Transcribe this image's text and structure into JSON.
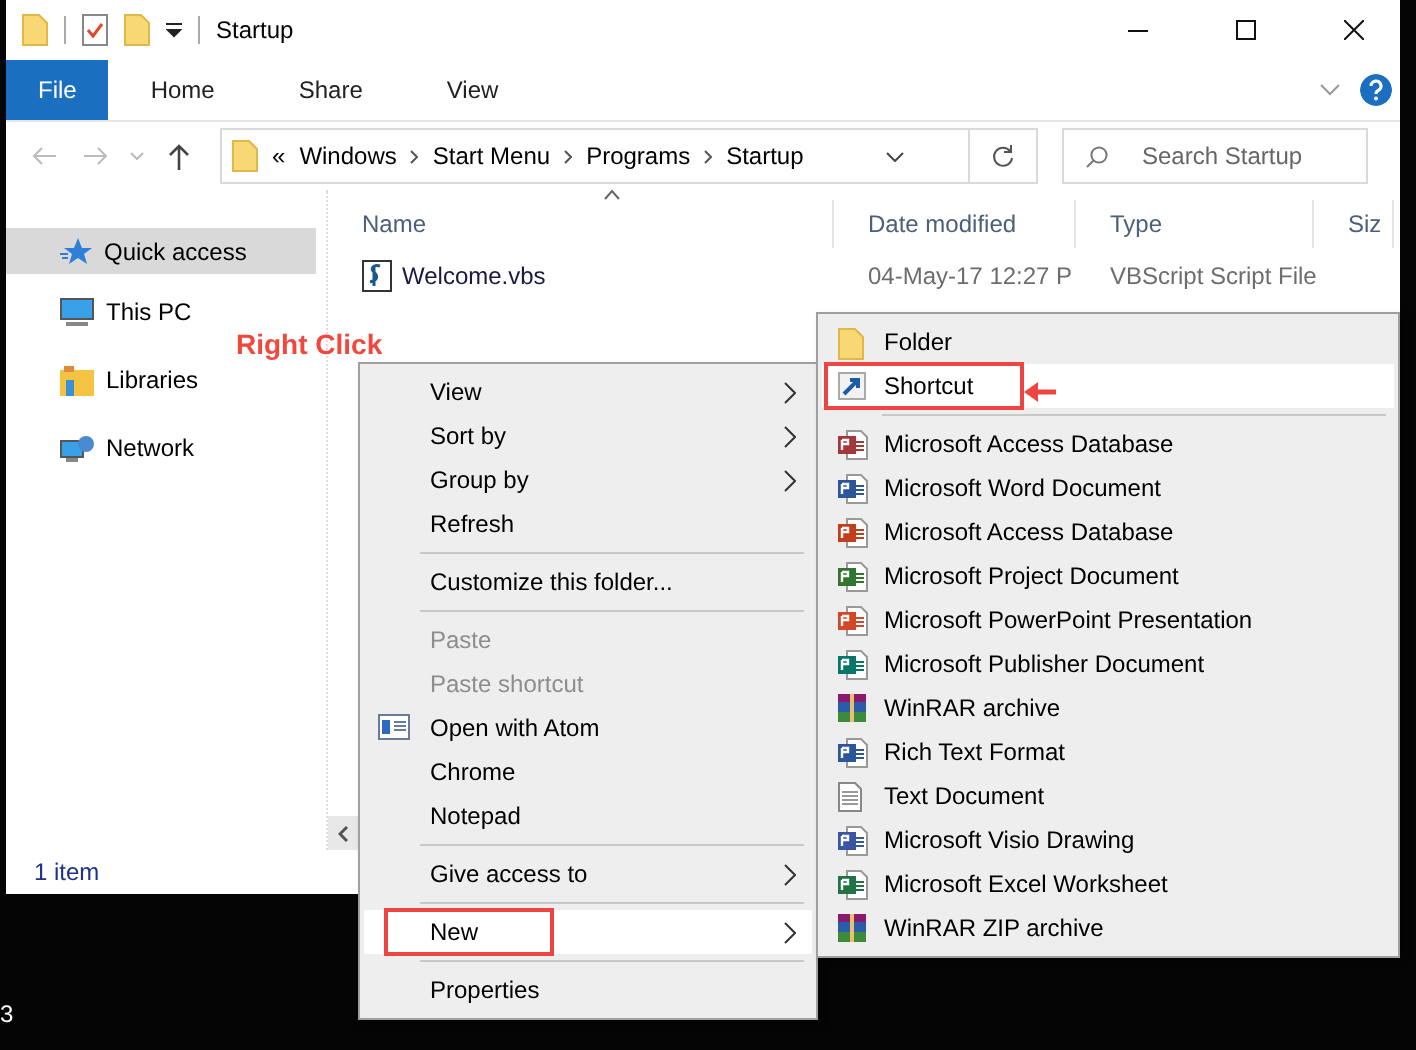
{
  "window": {
    "title": "Startup"
  },
  "ribbon": {
    "tabs": [
      {
        "label": "File",
        "kind": "file"
      },
      {
        "label": "Home",
        "kind": "tab"
      },
      {
        "label": "Share",
        "kind": "tab"
      },
      {
        "label": "View",
        "kind": "tab"
      }
    ]
  },
  "address_bar": {
    "overflow_mark": "«",
    "path": [
      "Windows",
      "Start Menu",
      "Programs",
      "Startup"
    ]
  },
  "search": {
    "placeholder": "Search Startup"
  },
  "navigation": {
    "items": [
      {
        "label": "Quick access",
        "kind": "star",
        "selected": true
      },
      {
        "label": "This PC",
        "kind": "pc",
        "selected": false
      },
      {
        "label": "Libraries",
        "kind": "libraries",
        "selected": false
      },
      {
        "label": "Network",
        "kind": "network",
        "selected": false
      }
    ]
  },
  "table": {
    "columns": [
      "Name",
      "Date modified",
      "Type",
      "Siz"
    ],
    "rows": [
      {
        "name": "Welcome.vbs",
        "date_modified": "04-May-17 12:27 P",
        "type": "VBScript Script File"
      }
    ]
  },
  "status_bar": {
    "item_count": "1 item"
  },
  "annotation": {
    "label": "Right Click"
  },
  "context_menu": {
    "items": [
      {
        "kind": "item",
        "label": "View",
        "submenu": true,
        "disabled": false,
        "selected": false,
        "outlined": false,
        "icon": false
      },
      {
        "kind": "item",
        "label": "Sort by",
        "submenu": true,
        "disabled": false,
        "selected": false,
        "outlined": false,
        "icon": false
      },
      {
        "kind": "item",
        "label": "Group by",
        "submenu": true,
        "disabled": false,
        "selected": false,
        "outlined": false,
        "icon": false
      },
      {
        "kind": "item",
        "label": "Refresh",
        "submenu": false,
        "disabled": false,
        "selected": false,
        "outlined": false,
        "icon": false
      },
      {
        "kind": "separator"
      },
      {
        "kind": "item",
        "label": "Customize this folder...",
        "submenu": false,
        "disabled": false,
        "selected": false,
        "outlined": false,
        "icon": false
      },
      {
        "kind": "separator"
      },
      {
        "kind": "item",
        "label": "Paste",
        "submenu": false,
        "disabled": true,
        "selected": false,
        "outlined": false,
        "icon": false
      },
      {
        "kind": "item",
        "label": "Paste shortcut",
        "submenu": false,
        "disabled": true,
        "selected": false,
        "outlined": false,
        "icon": false
      },
      {
        "kind": "item",
        "label": "Open with Atom",
        "submenu": false,
        "disabled": false,
        "selected": false,
        "outlined": false,
        "icon": true
      },
      {
        "kind": "item",
        "label": "Chrome",
        "submenu": false,
        "disabled": false,
        "selected": false,
        "outlined": false,
        "icon": false
      },
      {
        "kind": "item",
        "label": "Notepad",
        "submenu": false,
        "disabled": false,
        "selected": false,
        "outlined": false,
        "icon": false
      },
      {
        "kind": "separator"
      },
      {
        "kind": "item",
        "label": "Give access to",
        "submenu": true,
        "disabled": false,
        "selected": false,
        "outlined": false,
        "icon": false
      },
      {
        "kind": "separator"
      },
      {
        "kind": "item",
        "label": "New",
        "submenu": true,
        "disabled": false,
        "selected": true,
        "outlined": true,
        "icon": false
      },
      {
        "kind": "separator"
      },
      {
        "kind": "item",
        "label": "Properties",
        "submenu": false,
        "disabled": false,
        "selected": false,
        "outlined": false,
        "icon": false
      }
    ]
  },
  "new_submenu": {
    "items": [
      {
        "kind": "folder",
        "label": "Folder",
        "selected": false,
        "outlined": false
      },
      {
        "kind": "shortcut",
        "label": "Shortcut",
        "selected": true,
        "outlined": true
      },
      {
        "kind": "separator"
      },
      {
        "kind": "access",
        "label": "Microsoft Access Database",
        "selected": false,
        "outlined": false
      },
      {
        "kind": "word",
        "label": "Microsoft Word Document",
        "selected": false,
        "outlined": false
      },
      {
        "kind": "access-alt",
        "label": "Microsoft Access Database",
        "selected": false,
        "outlined": false
      },
      {
        "kind": "project",
        "label": "Microsoft Project Document",
        "selected": false,
        "outlined": false
      },
      {
        "kind": "powerpoint",
        "label": "Microsoft PowerPoint Presentation",
        "selected": false,
        "outlined": false
      },
      {
        "kind": "publisher",
        "label": "Microsoft Publisher Document",
        "selected": false,
        "outlined": false
      },
      {
        "kind": "archive",
        "label": "WinRAR archive",
        "selected": false,
        "outlined": false
      },
      {
        "kind": "word",
        "label": "Rich Text Format",
        "selected": false,
        "outlined": false
      },
      {
        "kind": "text",
        "label": "Text Document",
        "selected": false,
        "outlined": false
      },
      {
        "kind": "visio",
        "label": "Microsoft Visio Drawing",
        "selected": false,
        "outlined": false
      },
      {
        "kind": "excel",
        "label": "Microsoft Excel Worksheet",
        "selected": false,
        "outlined": false
      },
      {
        "kind": "archive",
        "label": "WinRAR ZIP archive",
        "selected": false,
        "outlined": false
      }
    ]
  },
  "desktop": {
    "fragment_text": "3"
  }
}
